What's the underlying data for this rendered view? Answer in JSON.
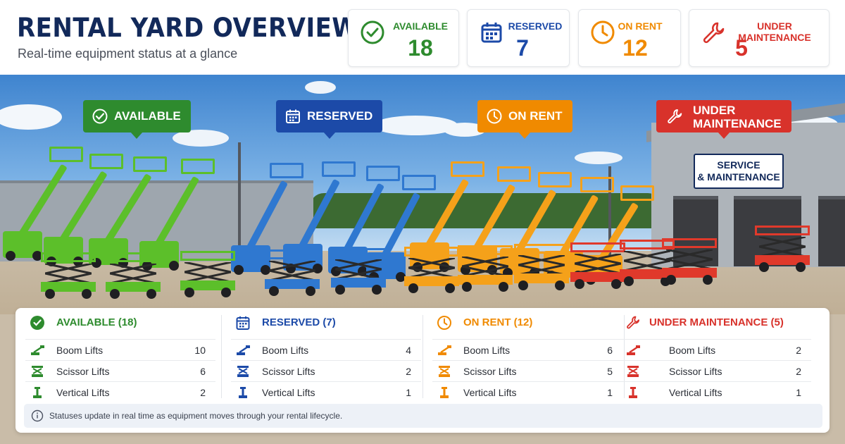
{
  "header": {
    "title": "RENTAL YARD OVERVIEW",
    "subtitle": "Real-time equipment status at a glance"
  },
  "stats": [
    {
      "label": "AVAILABLE",
      "value": "18",
      "color": "#2e8b2e",
      "icon": "check-circle-icon"
    },
    {
      "label": "RESERVED",
      "value": "7",
      "color": "#1c4aa8",
      "icon": "calendar-icon"
    },
    {
      "label": "ON RENT",
      "value": "12",
      "color": "#f08a00",
      "icon": "clock-icon"
    },
    {
      "label": "UNDER MAINTENANCE",
      "value": "5",
      "color": "#d8322b",
      "icon": "wrench-icon"
    }
  ],
  "markers": {
    "available": "AVAILABLE",
    "reserved": "RESERVED",
    "on_rent": "ON RENT",
    "maintenance_line1": "UNDER",
    "maintenance_line2": "MAINTENANCE"
  },
  "building_sign": {
    "line1": "SERVICE",
    "line2": "& MAINTENANCE"
  },
  "summary": [
    {
      "heading": "AVAILABLE (18)",
      "color": "#2e8b2e",
      "rows": [
        {
          "label": "Boom Lifts",
          "value": "10"
        },
        {
          "label": "Scissor Lifts",
          "value": "6"
        },
        {
          "label": "Vertical Lifts",
          "value": "2"
        }
      ]
    },
    {
      "heading": "RESERVED (7)",
      "color": "#1c4aa8",
      "rows": [
        {
          "label": "Boom Lifts",
          "value": "4"
        },
        {
          "label": "Scissor Lifts",
          "value": "2"
        },
        {
          "label": "Vertical Lifts",
          "value": "1"
        }
      ]
    },
    {
      "heading": "ON RENT (12)",
      "color": "#f08a00",
      "rows": [
        {
          "label": "Boom Lifts",
          "value": "6"
        },
        {
          "label": "Scissor Lifts",
          "value": "5"
        },
        {
          "label": "Vertical Lifts",
          "value": "1"
        }
      ]
    },
    {
      "heading": "UNDER MAINTENANCE (5)",
      "color": "#d8322b",
      "rows": [
        {
          "label": "Boom Lifts",
          "value": "2"
        },
        {
          "label": "Scissor Lifts",
          "value": "2"
        },
        {
          "label": "Vertical Lifts",
          "value": "1"
        }
      ]
    }
  ],
  "info_text": "Statuses update in real time as equipment moves through your rental lifecycle.",
  "colors": {
    "navy": "#12295a",
    "green_machine": "#5cbf2a",
    "blue_machine": "#2f78d0",
    "orange_machine": "#f5a11a",
    "red_machine": "#e0392b"
  }
}
